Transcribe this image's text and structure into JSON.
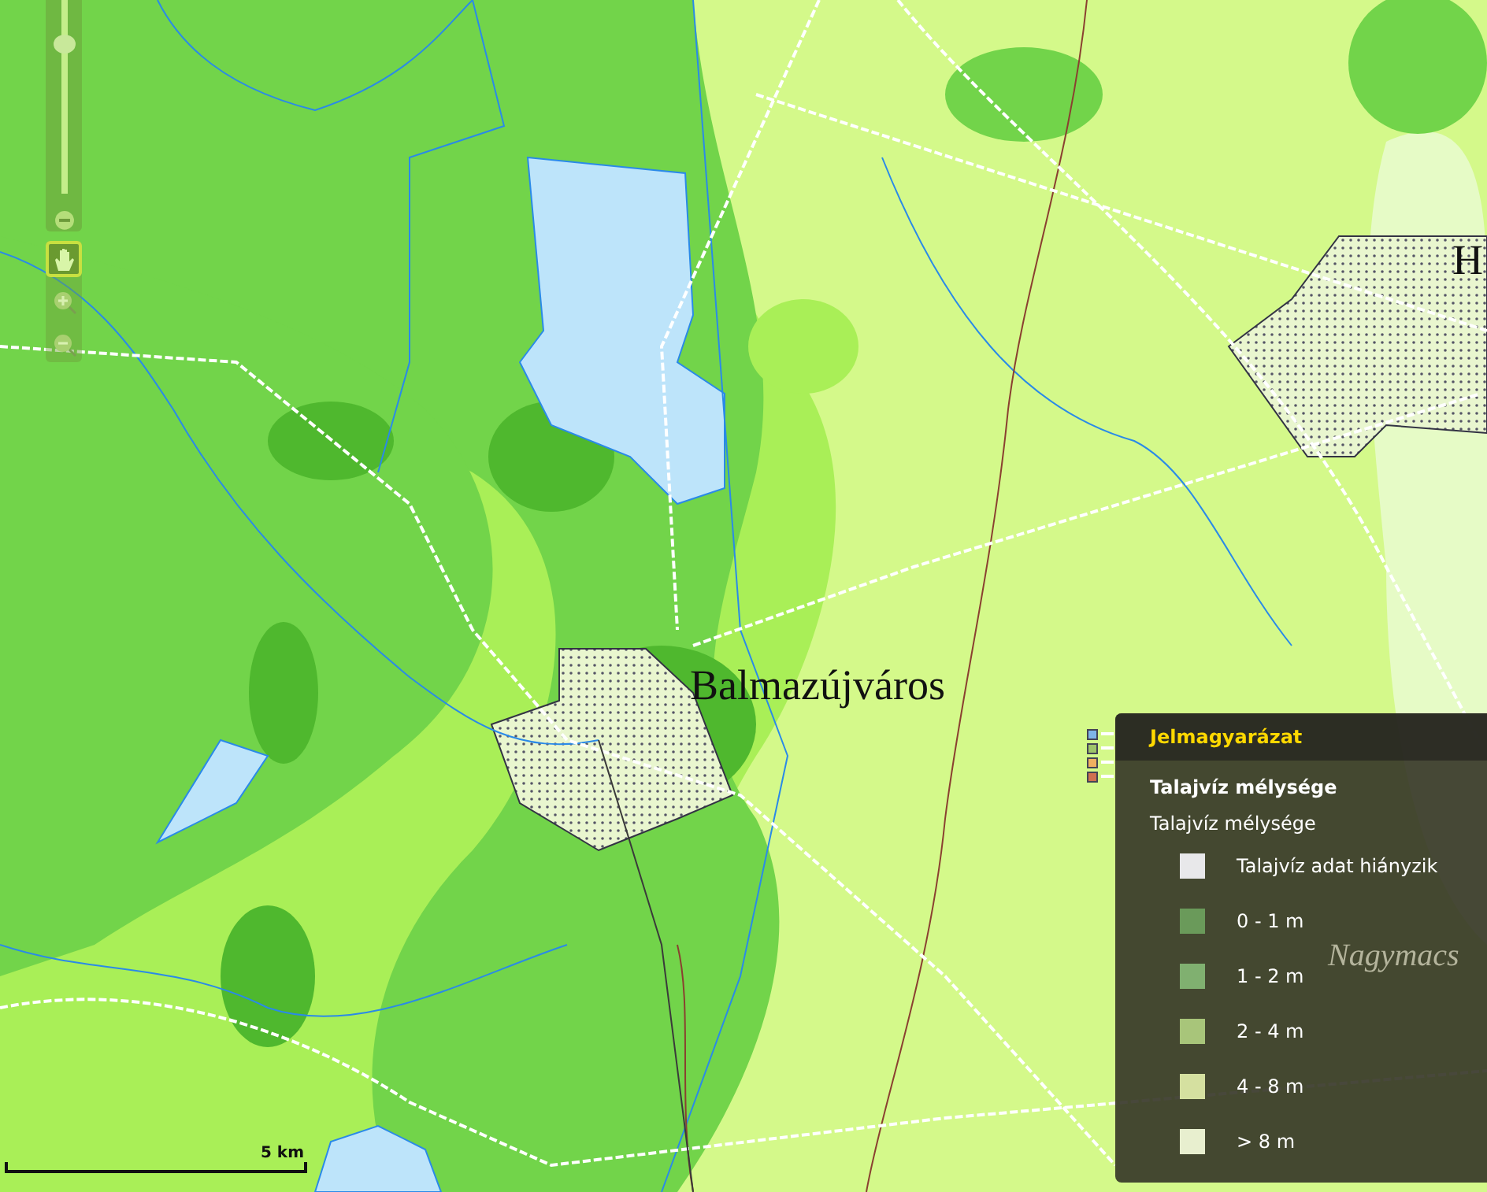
{
  "map": {
    "place_labels": [
      {
        "text": "Balmazújváros",
        "kind": "town"
      },
      {
        "text": "H",
        "kind": "town"
      },
      {
        "text": "Nagymacs",
        "kind": "village"
      }
    ],
    "scale": {
      "label": "5 km"
    }
  },
  "zoom_control": {
    "level": 0.8
  },
  "tools": [
    {
      "kind": "pan",
      "selected": true
    },
    {
      "kind": "zoom_in",
      "selected": false
    },
    {
      "kind": "zoom_out",
      "selected": false
    }
  ],
  "legend": {
    "title": "Jelmagyarázat",
    "layer_title": "Talajvíz mélysége",
    "subtitle": "Talajvíz mélysége",
    "items": [
      {
        "label": "Talajvíz adat hiányzik",
        "color": "#e8e8ea"
      },
      {
        "label": "0 - 1 m",
        "color": "#6a9a5a"
      },
      {
        "label": "1 - 2 m",
        "color": "#80b070"
      },
      {
        "label": "2 - 4 m",
        "color": "#a8c57a"
      },
      {
        "label": "4 - 8 m",
        "color": "#d5e0a0"
      },
      {
        "label": "> 8 m",
        "color": "#e8efcf"
      }
    ]
  }
}
